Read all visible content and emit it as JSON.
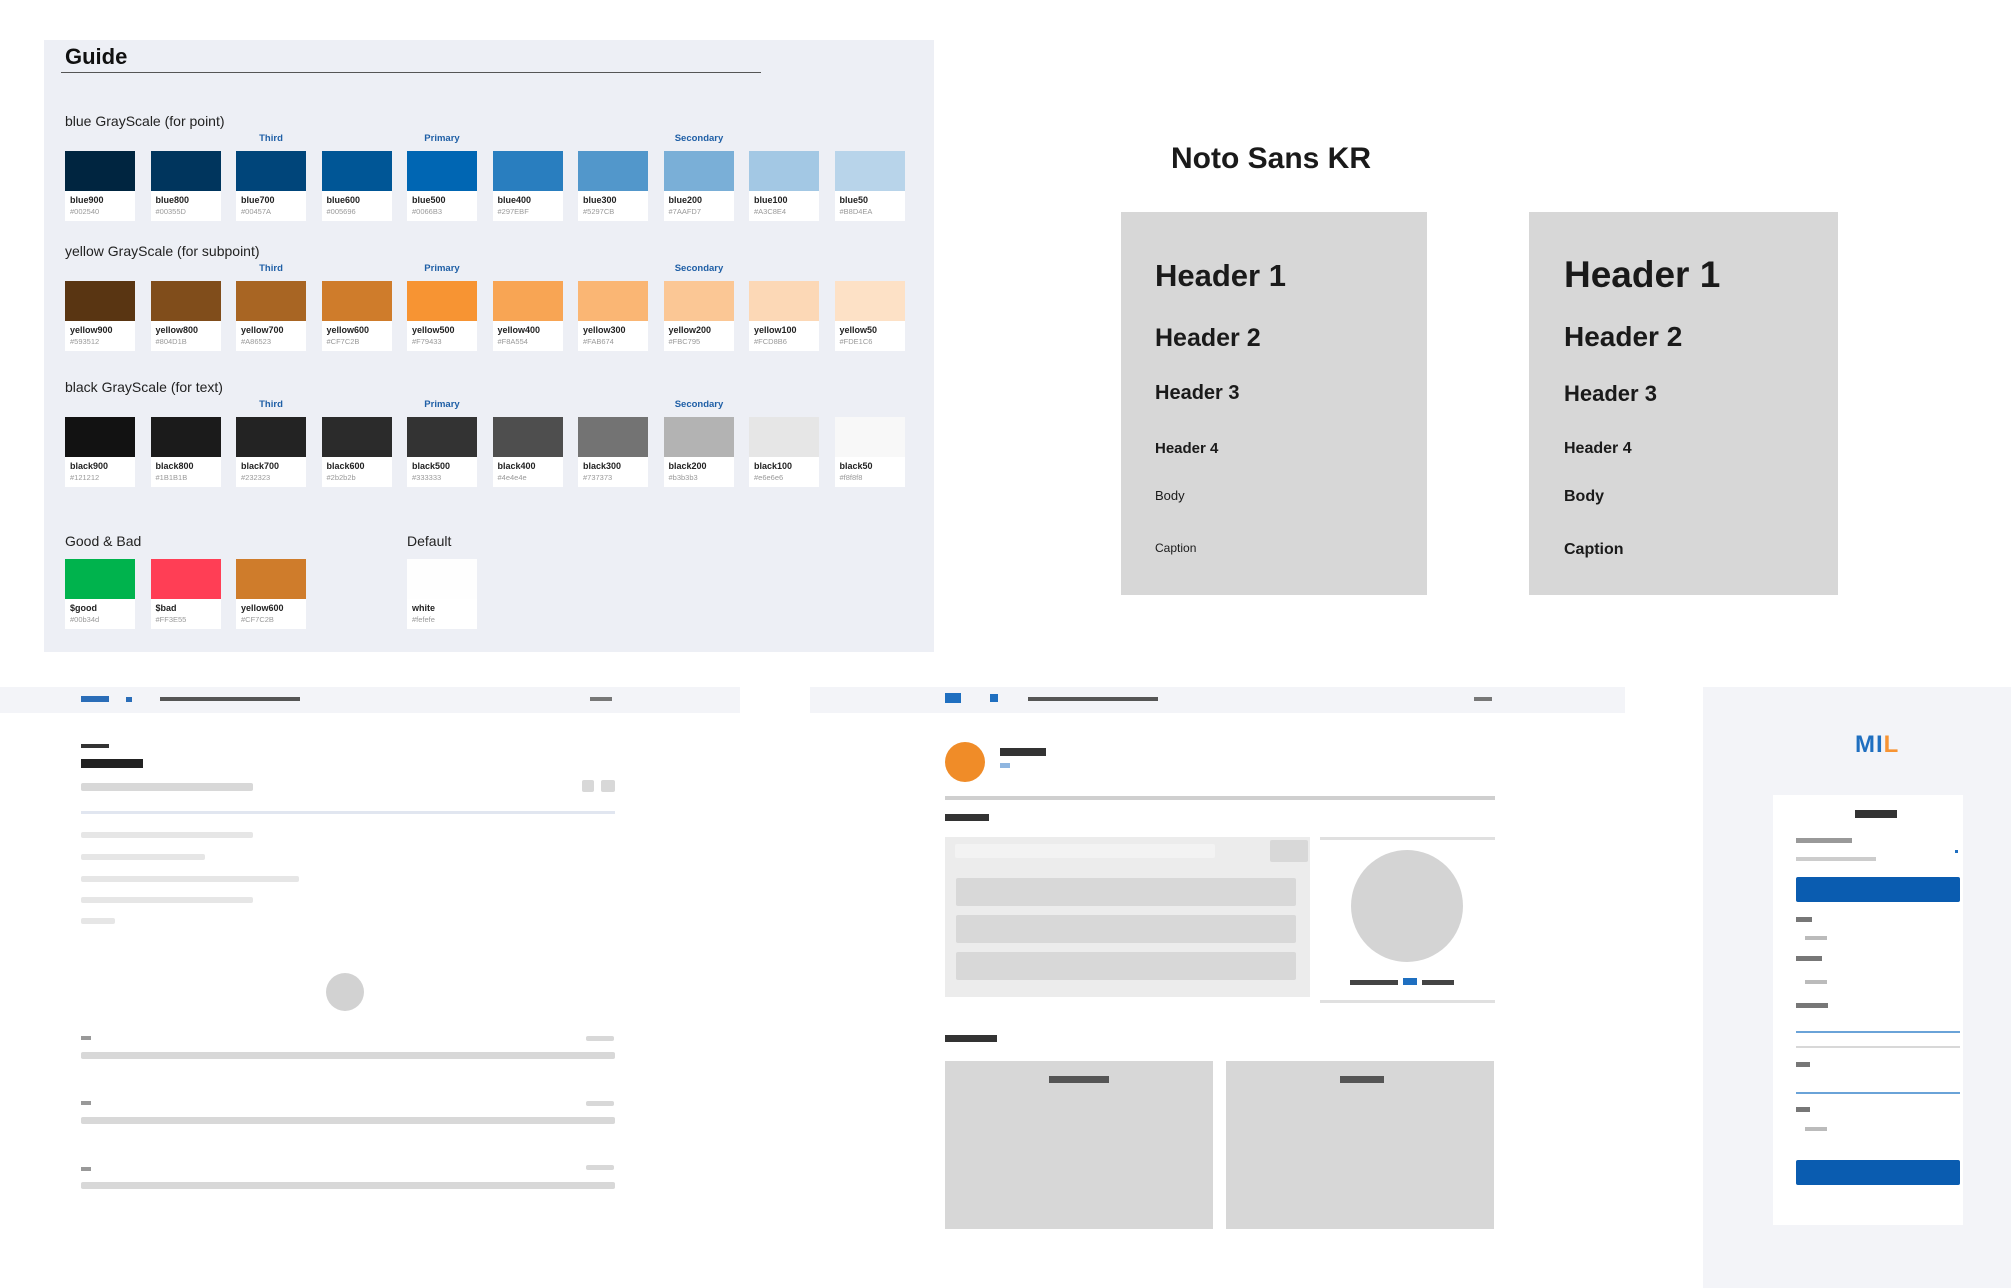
{
  "guide": {
    "title": "Guide",
    "rows": [
      {
        "label": "blue GrayScale (for point)",
        "markers": {
          "third": "Third",
          "primary": "Primary",
          "secondary": "Secondary"
        },
        "swatches": [
          {
            "name": "blue900",
            "hex": "#002540",
            "color": "#002540"
          },
          {
            "name": "blue800",
            "hex": "#00355D",
            "color": "#00355d"
          },
          {
            "name": "blue700",
            "hex": "#00457A",
            "color": "#00457a"
          },
          {
            "name": "blue600",
            "hex": "#005696",
            "color": "#005696"
          },
          {
            "name": "blue500",
            "hex": "#0066B3",
            "color": "#0066b3"
          },
          {
            "name": "blue400",
            "hex": "#297EBF",
            "color": "#297ebf"
          },
          {
            "name": "blue300",
            "hex": "#5297CB",
            "color": "#5297cb"
          },
          {
            "name": "blue200",
            "hex": "#7AAFD7",
            "color": "#7aafd7"
          },
          {
            "name": "blue100",
            "hex": "#A3C8E4",
            "color": "#a3c8e4"
          },
          {
            "name": "blue50",
            "hex": "#B8D4EA",
            "color": "#b8d4ea"
          }
        ]
      },
      {
        "label": "yellow GrayScale (for subpoint)",
        "markers": {
          "third": "Third",
          "primary": "Primary",
          "secondary": "Secondary"
        },
        "swatches": [
          {
            "name": "yellow900",
            "hex": "#593512",
            "color": "#593512"
          },
          {
            "name": "yellow800",
            "hex": "#804D1B",
            "color": "#804d1b"
          },
          {
            "name": "yellow700",
            "hex": "#A86523",
            "color": "#a86523"
          },
          {
            "name": "yellow600",
            "hex": "#CF7C2B",
            "color": "#cf7c2b"
          },
          {
            "name": "yellow500",
            "hex": "#F79433",
            "color": "#f79433"
          },
          {
            "name": "yellow400",
            "hex": "#F8A554",
            "color": "#f8a554"
          },
          {
            "name": "yellow300",
            "hex": "#FAB674",
            "color": "#fab674"
          },
          {
            "name": "yellow200",
            "hex": "#FBC795",
            "color": "#fbc795"
          },
          {
            "name": "yellow100",
            "hex": "#FCD8B6",
            "color": "#fcd8b6"
          },
          {
            "name": "yellow50",
            "hex": "#FDE1C6",
            "color": "#fde1c6"
          }
        ]
      },
      {
        "label": "black GrayScale (for text)",
        "markers": {
          "third": "Third",
          "primary": "Primary",
          "secondary": "Secondary"
        },
        "swatches": [
          {
            "name": "black900",
            "hex": "#121212",
            "color": "#121212"
          },
          {
            "name": "black800",
            "hex": "#1B1B1B",
            "color": "#1b1b1b"
          },
          {
            "name": "black700",
            "hex": "#232323",
            "color": "#232323"
          },
          {
            "name": "black600",
            "hex": "#2b2b2b",
            "color": "#2b2b2b"
          },
          {
            "name": "black500",
            "hex": "#333333",
            "color": "#333333"
          },
          {
            "name": "black400",
            "hex": "#4e4e4e",
            "color": "#4e4e4e"
          },
          {
            "name": "black300",
            "hex": "#737373",
            "color": "#737373"
          },
          {
            "name": "black200",
            "hex": "#b3b3b3",
            "color": "#b3b3b3"
          },
          {
            "name": "black100",
            "hex": "#e6e6e6",
            "color": "#e6e6e6"
          },
          {
            "name": "black50",
            "hex": "#f8f8f8",
            "color": "#f8f8f8"
          }
        ]
      }
    ],
    "good_bad": {
      "label": "Good & Bad",
      "swatches": [
        {
          "name": "$good",
          "hex": "#00b34d",
          "color": "#00b34d"
        },
        {
          "name": "$bad",
          "hex": "#FF3E55",
          "color": "#ff3e55"
        },
        {
          "name": "yellow600",
          "hex": "#CF7C2B",
          "color": "#cf7c2b"
        }
      ]
    },
    "default": {
      "label": "Default",
      "swatch": {
        "name": "white",
        "hex": "#fefefe",
        "color": "#fefefe"
      }
    }
  },
  "typography": {
    "font_name": "Noto Sans KR",
    "cards": [
      {
        "items": [
          "Header 1",
          "Header 2",
          "Header 3",
          "Header 4",
          "Body",
          "Caption"
        ]
      },
      {
        "items": [
          "Header 1",
          "Header 2",
          "Header 3",
          "Header 4",
          "Body",
          "Caption"
        ]
      }
    ]
  },
  "mobile": {
    "logo_parts": [
      "MI",
      "L"
    ],
    "logo_colors": {
      "mi": "#1f6fc0",
      "l": "#f79433"
    }
  }
}
